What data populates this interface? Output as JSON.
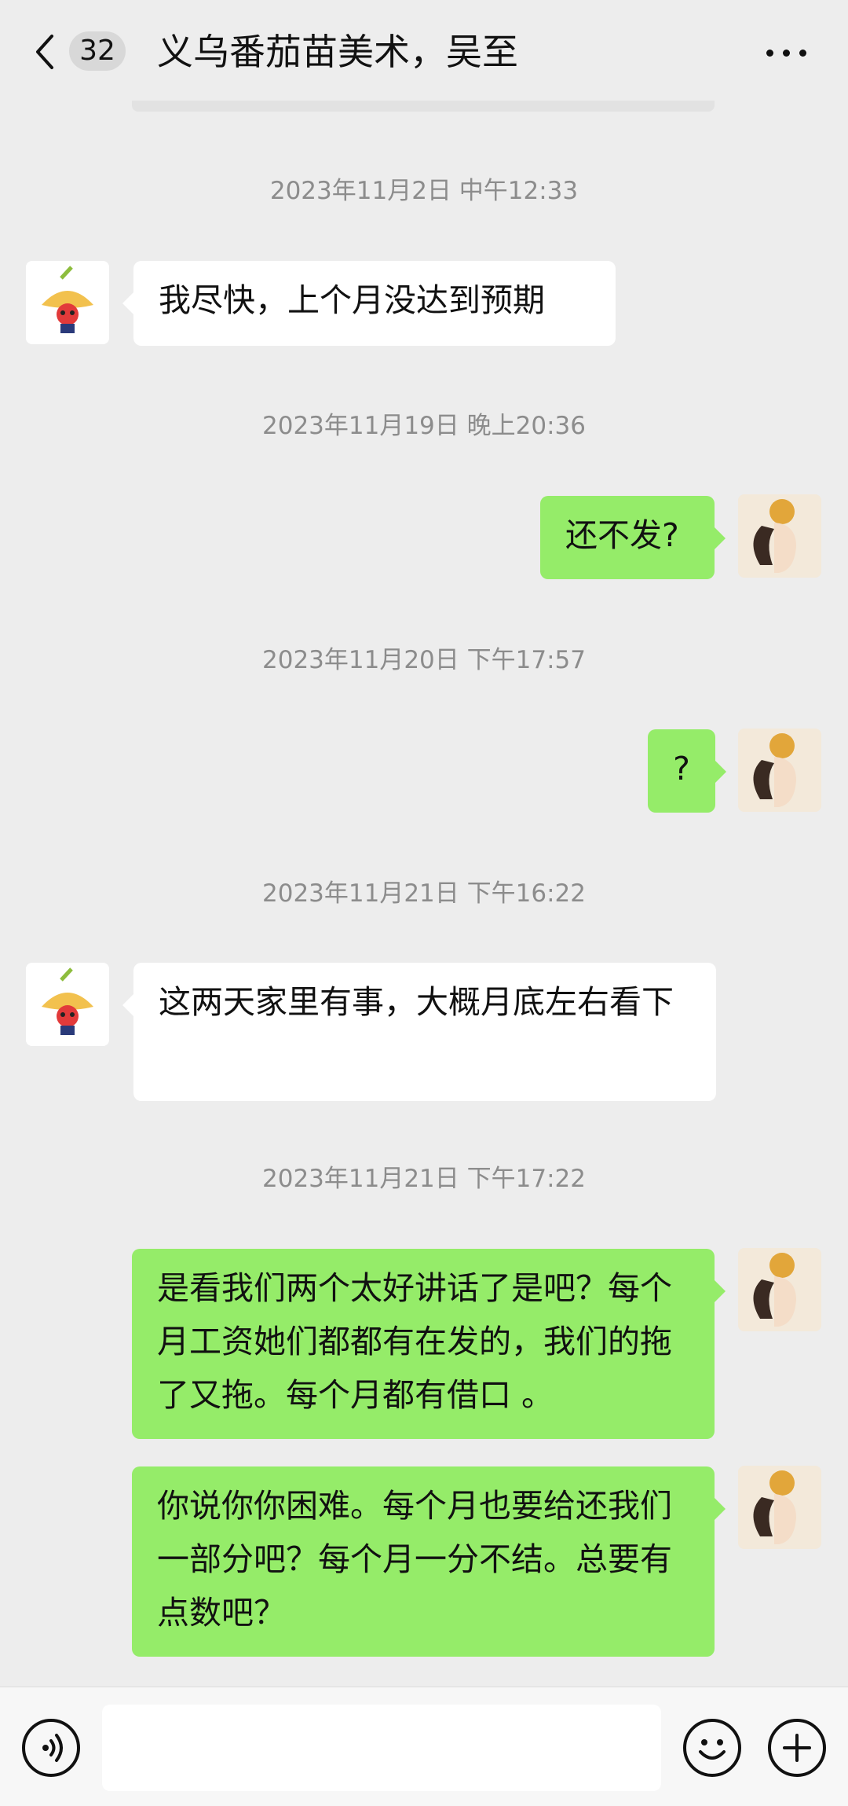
{
  "header": {
    "back_icon": "chevron-left-icon",
    "unread_count": "32",
    "title": "义乌番茄苗美术，吴至",
    "more_icon": "more-dots-icon"
  },
  "messages": [
    {
      "type": "timestamp",
      "text": "2023年11月2日 中午12:33"
    },
    {
      "type": "message",
      "side": "left",
      "text": "我尽快，上个月没达到预期"
    },
    {
      "type": "timestamp",
      "text": "2023年11月19日 晚上20:36"
    },
    {
      "type": "message",
      "side": "right",
      "text": "还不发?"
    },
    {
      "type": "timestamp",
      "text": "2023年11月20日 下午17:57"
    },
    {
      "type": "message",
      "side": "right",
      "text": "?"
    },
    {
      "type": "timestamp",
      "text": "2023年11月21日 下午16:22"
    },
    {
      "type": "message",
      "side": "left",
      "text": "这两天家里有事，大概月底左右看下"
    },
    {
      "type": "timestamp",
      "text": "2023年11月21日 下午17:22"
    },
    {
      "type": "message",
      "side": "right",
      "text": "是看我们两个太好讲话了是吧？每个月工资她们都都有在发的，我们的拖了又拖。每个月都有借口 。"
    },
    {
      "type": "message",
      "side": "right",
      "text": "你说你你困难。每个月也要给还我们一部分吧？每个月一分不结。总要有点数吧？"
    }
  ],
  "input_bar": {
    "voice_icon": "voice-icon",
    "input_value": "",
    "emoji_icon": "emoji-icon",
    "plus_icon": "plus-icon"
  },
  "colors": {
    "background": "#ededed",
    "bubble_self": "#95ec69",
    "bubble_other": "#ffffff",
    "timestamp_text": "#8c8c8c"
  }
}
